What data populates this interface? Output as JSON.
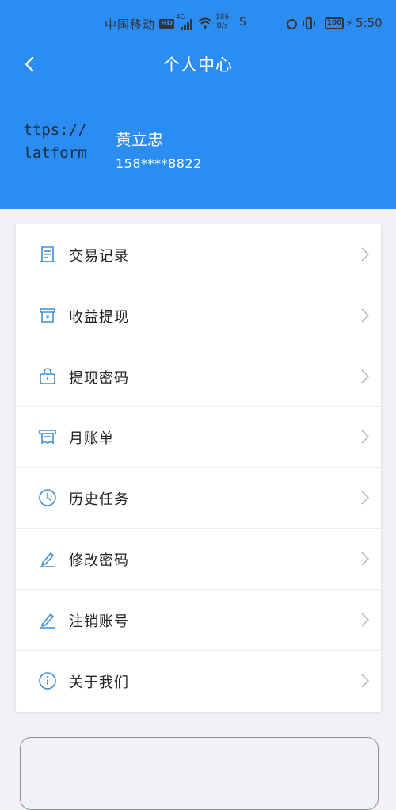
{
  "status_bar": {
    "carrier": "中国移动",
    "hd_badge": "HD",
    "network": "4G",
    "speed_value": "186",
    "speed_unit": "B/s",
    "extra": "S",
    "battery": "100",
    "time": "5:50"
  },
  "nav": {
    "title": "个人中心",
    "back_icon": "chevron-left-icon"
  },
  "profile": {
    "avatar_text_line1": "https://",
    "avatar_text_line2": "platform",
    "name": "黄立忠",
    "phone": "158****8822"
  },
  "menu": {
    "items": [
      {
        "label": "交易记录",
        "icon": "receipt-icon"
      },
      {
        "label": "收益提现",
        "icon": "cash-box-icon"
      },
      {
        "label": "提现密码",
        "icon": "lock-icon"
      },
      {
        "label": "月账单",
        "icon": "bill-icon"
      },
      {
        "label": "历史任务",
        "icon": "clock-icon"
      },
      {
        "label": "修改密码",
        "icon": "pencil-icon"
      },
      {
        "label": "注销账号",
        "icon": "pencil-icon"
      },
      {
        "label": "关于我们",
        "icon": "info-icon"
      }
    ]
  },
  "colors": {
    "header_blue": "#2b8df2",
    "icon_blue": "#3d8fd6",
    "background": "#f0f2f5"
  }
}
